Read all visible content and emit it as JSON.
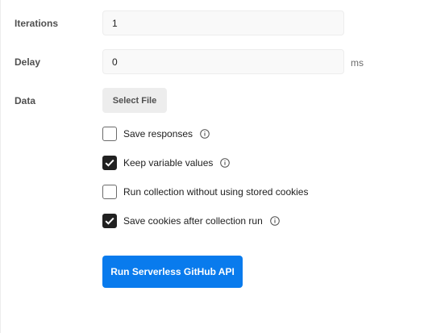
{
  "iterations": {
    "label": "Iterations",
    "value": "1"
  },
  "delay": {
    "label": "Delay",
    "value": "0",
    "unit": "ms"
  },
  "data": {
    "label": "Data",
    "button_label": "Select File"
  },
  "options": [
    {
      "label": "Save responses",
      "checked": false,
      "has_info": true
    },
    {
      "label": "Keep variable values",
      "checked": true,
      "has_info": true
    },
    {
      "label": "Run collection without using stored cookies",
      "checked": false,
      "has_info": false
    },
    {
      "label": "Save cookies after collection run",
      "checked": true,
      "has_info": true
    }
  ],
  "run_button": {
    "label": "Run Serverless GitHub API",
    "color": "#097bed"
  }
}
